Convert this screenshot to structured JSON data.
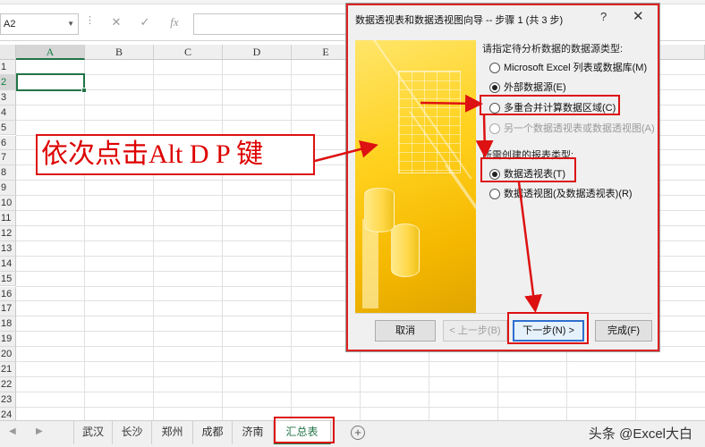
{
  "formula_bar": {
    "name_box": "A2",
    "cancel_icon": "✕",
    "enter_icon": "✓",
    "fx_label": "fx"
  },
  "grid": {
    "columns": [
      "A",
      "B",
      "C",
      "D",
      "E"
    ],
    "rows": [
      "1",
      "2",
      "3",
      "4",
      "5",
      "6",
      "7",
      "8",
      "9",
      "10",
      "11",
      "12",
      "13",
      "14",
      "15",
      "16",
      "17",
      "18",
      "19",
      "20",
      "21",
      "22",
      "23",
      "24"
    ],
    "active_cell": "A2"
  },
  "annotation": {
    "text": "依次点击Alt  D  P 键"
  },
  "dialog": {
    "title": "数据透视表和数据透视图向导 -- 步骤 1 (共 3 步)",
    "help": "?",
    "close": "✕",
    "source_section": "请指定待分析数据的数据源类型:",
    "source_options": [
      "Microsoft Excel 列表或数据库(M)",
      "外部数据源(E)",
      "多重合并计算数据区域(C)",
      "另一个数据透视表或数据透视图(A)"
    ],
    "report_section": "所需创建的报表类型:",
    "report_options": [
      "数据透视表(T)",
      "数据透视图(及数据透视表)(R)"
    ],
    "buttons": {
      "cancel": "取消",
      "back": "< 上一步(B)",
      "next": "下一步(N) >",
      "finish": "完成(F)"
    }
  },
  "sheet_tabs": [
    "武汉",
    "长沙",
    "郑州",
    "成都",
    "济南",
    "汇总表"
  ],
  "active_sheet": "汇总表",
  "watermark": "头条 @Excel大白",
  "colors": {
    "accent": "#217346",
    "annotation": "#dd1111",
    "art": "#ffd21f"
  }
}
